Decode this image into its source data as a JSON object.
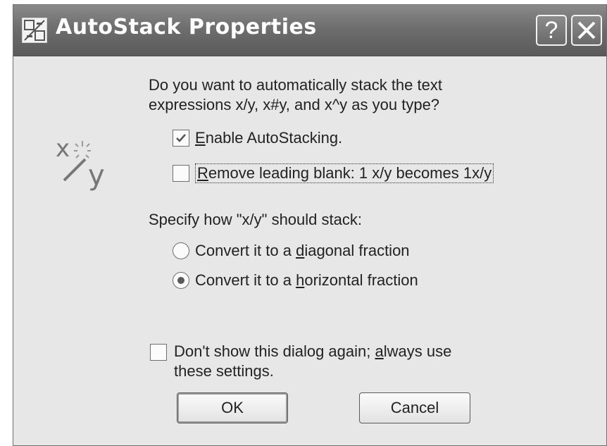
{
  "window": {
    "title": "AutoStack Properties",
    "help_glyph": "?",
    "icons": {
      "app": "autostack-app-icon",
      "help": "help-icon",
      "close": "close-icon",
      "stack": "stack-fraction-icon"
    }
  },
  "prompt": {
    "line1": "Do you want to automatically stack the text",
    "line2": "expressions x/y, x#y, and x^y as you type?"
  },
  "options": {
    "enable_autostacking": {
      "pre": "",
      "mnemonic": "E",
      "post": "nable AutoStacking.",
      "checked": true
    },
    "remove_leading_blank": {
      "pre": "",
      "mnemonic": "R",
      "post": "emove leading blank:  1 x/y  becomes  1x/y",
      "checked": false
    }
  },
  "stack_section": {
    "label": "Specify how \"x/y\" should stack:",
    "diagonal": {
      "pre": "Convert it to a ",
      "mnemonic": "d",
      "post": "iagonal fraction",
      "selected": false
    },
    "horizontal": {
      "pre": "Convert it to a ",
      "mnemonic": "h",
      "post": "orizontal fraction",
      "selected": true
    }
  },
  "dont_show": {
    "line1_pre": "Don't show this dialog again; ",
    "line1_mnemonic": "a",
    "line1_post": "lways use",
    "line2": "these settings.",
    "checked": false
  },
  "buttons": {
    "ok": "OK",
    "cancel": "Cancel"
  },
  "stack_icon_text": {
    "x": "x",
    "y": "y"
  }
}
